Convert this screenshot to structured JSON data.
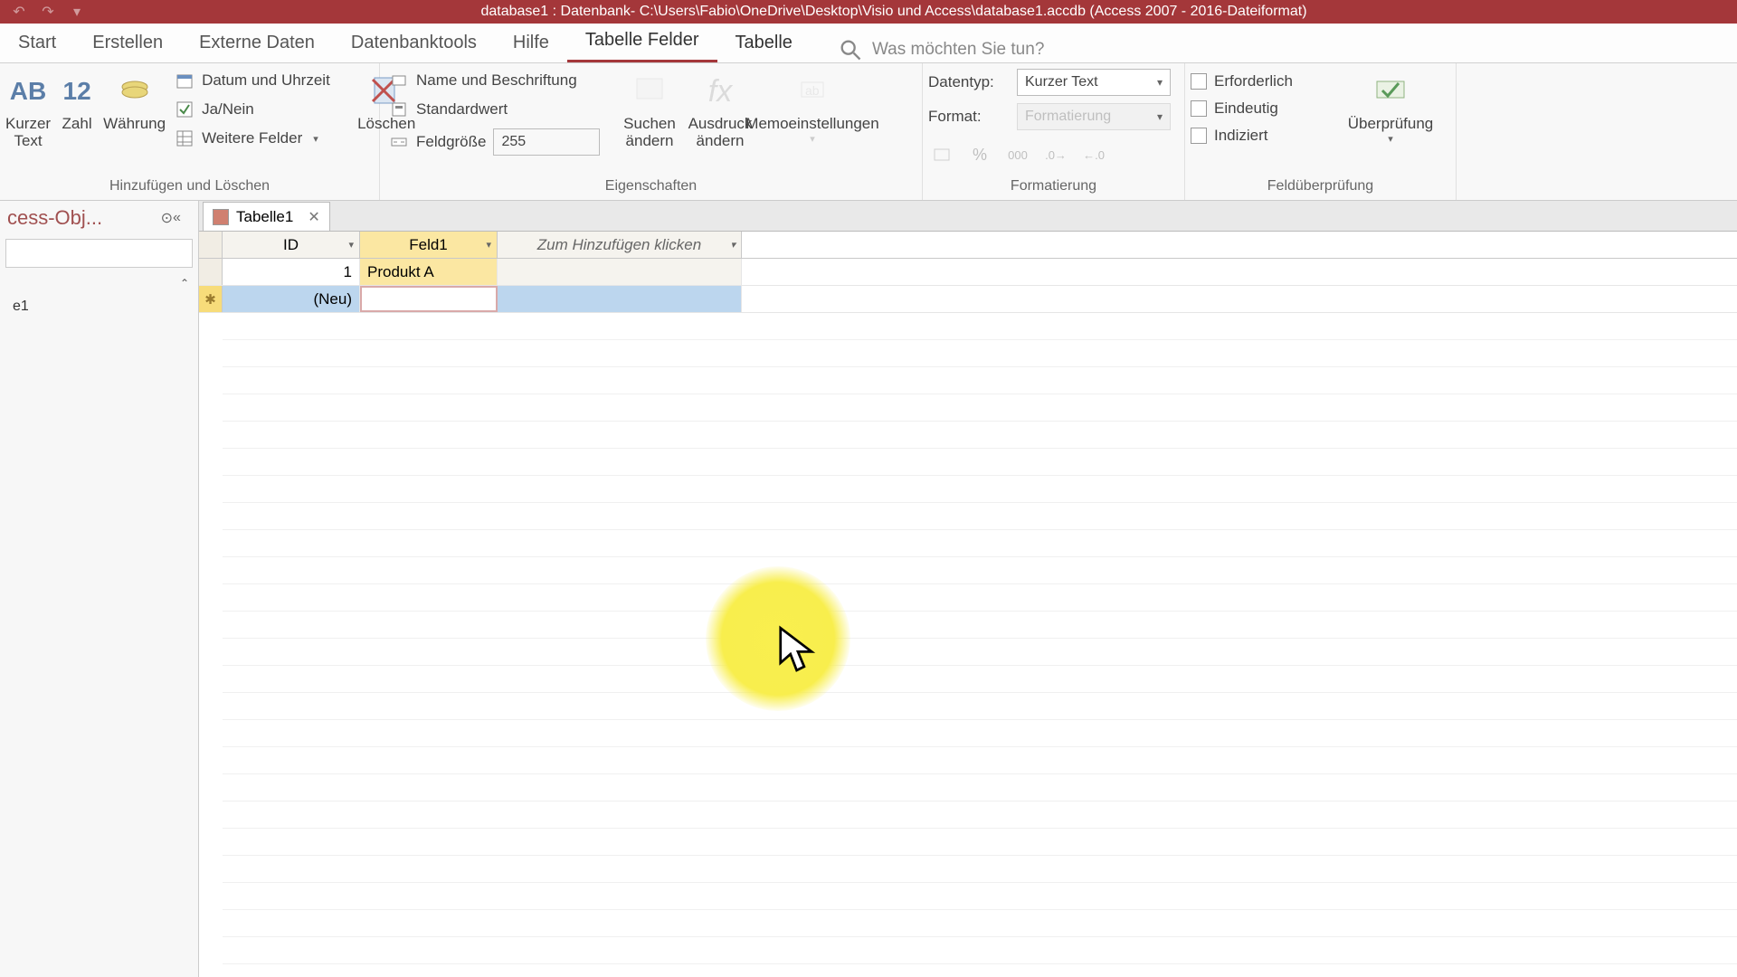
{
  "titlebar": {
    "title": "database1 : Datenbank- C:\\Users\\Fabio\\OneDrive\\Desktop\\Visio und Access\\database1.accdb (Access 2007 - 2016-Dateiformat)"
  },
  "ribbon_tabs": {
    "start": "Start",
    "erstellen": "Erstellen",
    "externe": "Externe Daten",
    "dbtools": "Datenbanktools",
    "hilfe": "Hilfe",
    "tabelle_felder": "Tabelle Felder",
    "tabelle": "Tabelle",
    "search_placeholder": "Was möchten Sie tun?"
  },
  "ribbon": {
    "groups": {
      "add_delete": "Hinzufügen und Löschen",
      "properties": "Eigenschaften",
      "formatting": "Formatierung",
      "validation": "Feldüberprüfung"
    },
    "btn_kurzer_text": "Kurzer Text",
    "btn_zahl": "Zahl",
    "btn_waehrung": "Währung",
    "btn_datum": "Datum und Uhrzeit",
    "btn_janein": "Ja/Nein",
    "btn_weitere": "Weitere Felder",
    "btn_loeschen": "Löschen",
    "btn_name": "Name und Beschriftung",
    "btn_standard": "Standardwert",
    "btn_feldgroesse": "Feldgröße",
    "feldgroesse_value": "255",
    "btn_suchen": "Suchen ändern",
    "btn_ausdruck": "Ausdruck ändern",
    "btn_memo": "Memoeinstellungen",
    "lbl_datentyp": "Datentyp:",
    "val_datentyp": "Kurzer Text",
    "lbl_format": "Format:",
    "val_format": "Formatierung",
    "chk_erforderlich": "Erforderlich",
    "chk_eindeutig": "Eindeutig",
    "chk_indiziert": "Indiziert",
    "btn_pruefung": "Überprüfung"
  },
  "navpane": {
    "title": "cess-Obj...",
    "item1": "e1"
  },
  "doc_tab": {
    "name": "Tabelle1"
  },
  "table": {
    "col_id": "ID",
    "col_f1": "Feld1",
    "col_add": "Zum Hinzufügen klicken",
    "row1_id": "1",
    "row1_f1": "Produkt A",
    "row_new": "(Neu)"
  }
}
